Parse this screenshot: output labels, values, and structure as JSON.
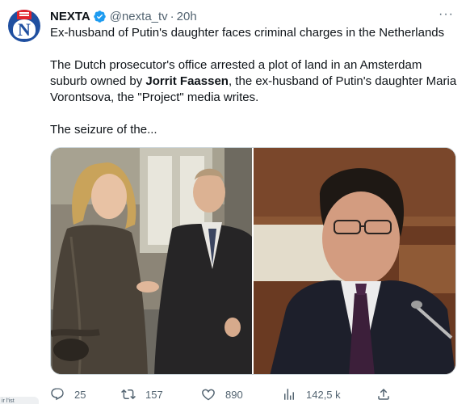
{
  "post": {
    "author_name": "NEXTA",
    "handle": "@nexta_tv",
    "separator": "·",
    "time": "20h",
    "avatar_letter": "N",
    "more_glyph": "···",
    "text": {
      "line1": "Ex-husband of Putin's daughter faces criminal charges in the Netherlands",
      "para2_before": "The Dutch prosecutor's office arrested a plot of land in an Amsterdam suburb owned by ",
      "para2_bold": "Jorrit Faassen",
      "para2_after": ", the ex-husband of Putin's daughter Maria Vorontsova, the \"Project\" media writes.",
      "para3": "The seizure of the..."
    }
  },
  "actions": {
    "replies": "25",
    "reposts": "157",
    "likes": "890",
    "views": "142,5 k"
  },
  "corner_tag": "ir l'ist",
  "colors": {
    "accent": "#1d9bf0",
    "muted": "#536471",
    "text": "#0f1419",
    "brand_blue": "#1f4fa0",
    "brand_red": "#e0242d"
  },
  "icons": [
    "verified-badge-icon",
    "more-icon",
    "reply-icon",
    "repost-icon",
    "like-icon",
    "views-icon",
    "share-icon"
  ]
}
